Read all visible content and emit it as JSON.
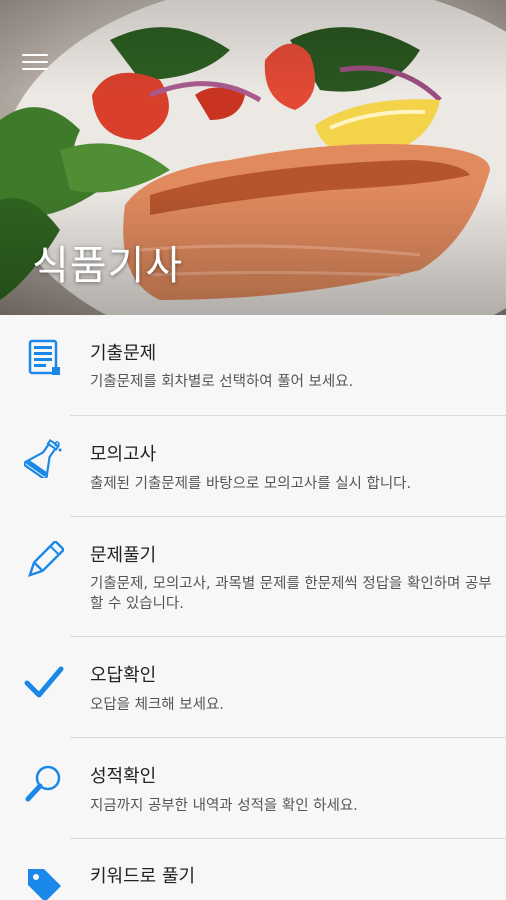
{
  "app": {
    "title": "식품기사"
  },
  "colors": {
    "icon_blue": "#1a88e8",
    "title_text": "#222222",
    "desc_text": "#555555",
    "divider": "#dcdcdc"
  },
  "menu": [
    {
      "icon": "document-list-icon",
      "title": "기출문제",
      "desc": "기출문제를 회차별로 선택하여 풀어 보세요."
    },
    {
      "icon": "flask-icon",
      "title": "모의고사",
      "desc": "출제된 기출문제를 바탕으로 모의고사를 실시 합니다."
    },
    {
      "icon": "pencil-icon",
      "title": "문제풀기",
      "desc": "기출문제, 모의고사, 과목별 문제를 한문제씩 정답을 확인하며 공부 할 수 있습니다."
    },
    {
      "icon": "checkmark-icon",
      "title": "오답확인",
      "desc": "오답을 체크해 보세요."
    },
    {
      "icon": "magnifier-icon",
      "title": "성적확인",
      "desc": "지금까지 공부한 내역과 성적을 확인 하세요."
    },
    {
      "icon": "tag-icon",
      "title": "키워드로 풀기",
      "desc": ""
    }
  ]
}
